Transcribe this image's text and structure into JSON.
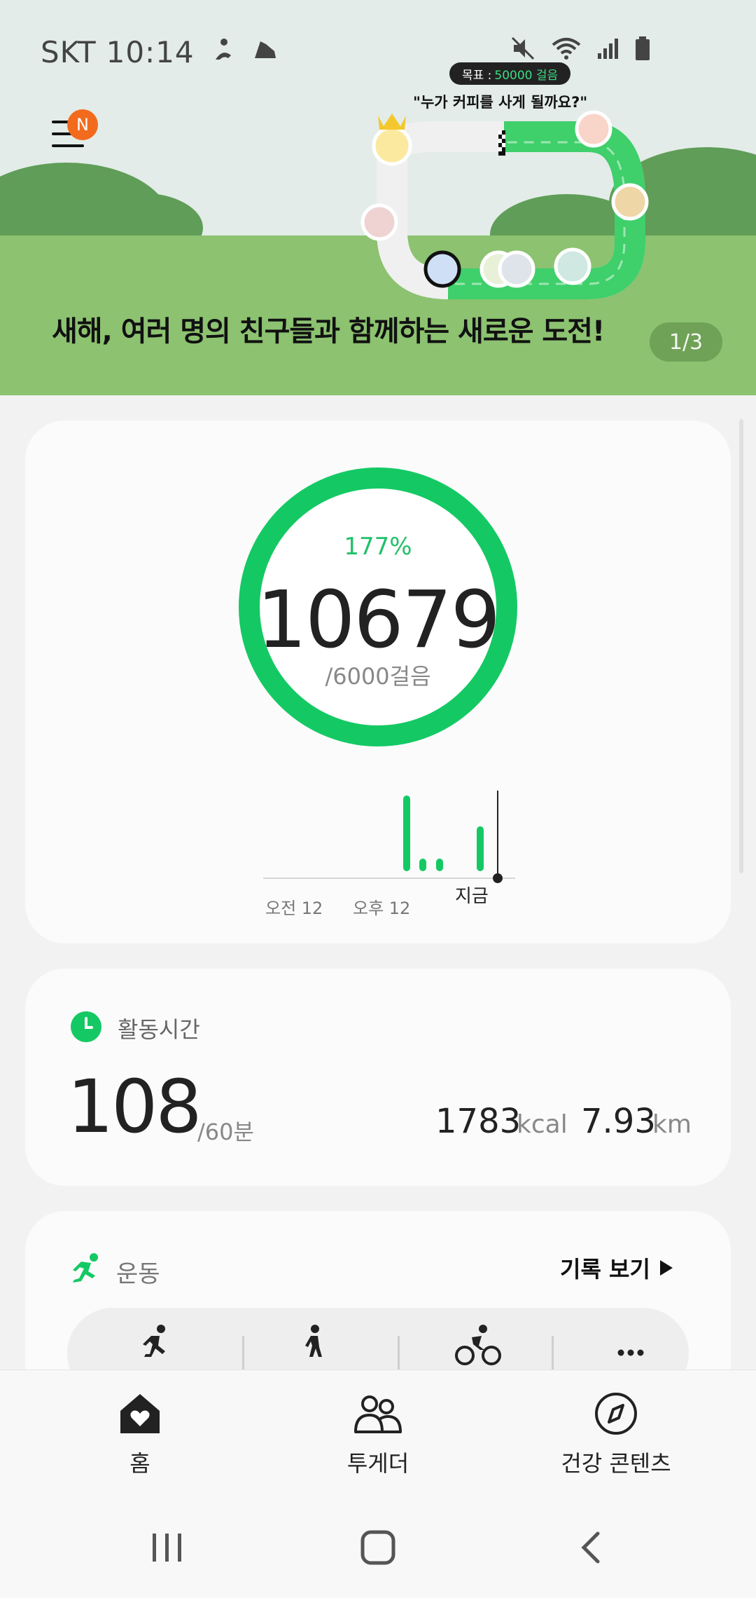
{
  "status_bar": {
    "carrier": "SKT",
    "time": "10:14"
  },
  "banner": {
    "menu_badge": "N",
    "goal_prefix": "목표 : ",
    "goal_value": "50000 걸음",
    "goal_quote": "\"누가 커피를 사게 될까요?\"",
    "title": "새해, 여러 명의 친구들과 함께하는 새로운 도전!",
    "pager": "1/3"
  },
  "steps": {
    "percent": "177%",
    "count": "10679",
    "goal": "/6000걸음",
    "progress_fraction": 1.0,
    "chart_labels": {
      "am": "오전 12",
      "pm": "오후 12",
      "now": "지금"
    }
  },
  "activity": {
    "title": "활동시간",
    "minutes": "108",
    "goal": "/60분",
    "kcal_value": "1783",
    "kcal_unit": "kcal",
    "km_value": "7.93",
    "km_unit": "km"
  },
  "exercise": {
    "title": "운동",
    "record_link": "기록 보기",
    "types": [
      "running-icon",
      "walking-icon",
      "cycling-icon",
      "more-icon"
    ]
  },
  "bottom_nav": {
    "home": "홈",
    "together": "투게더",
    "discover": "건강 콘텐츠"
  },
  "colors": {
    "accent_green": "#14c964",
    "banner_green": "#8cc270",
    "notification_orange": "#f26b1d"
  }
}
